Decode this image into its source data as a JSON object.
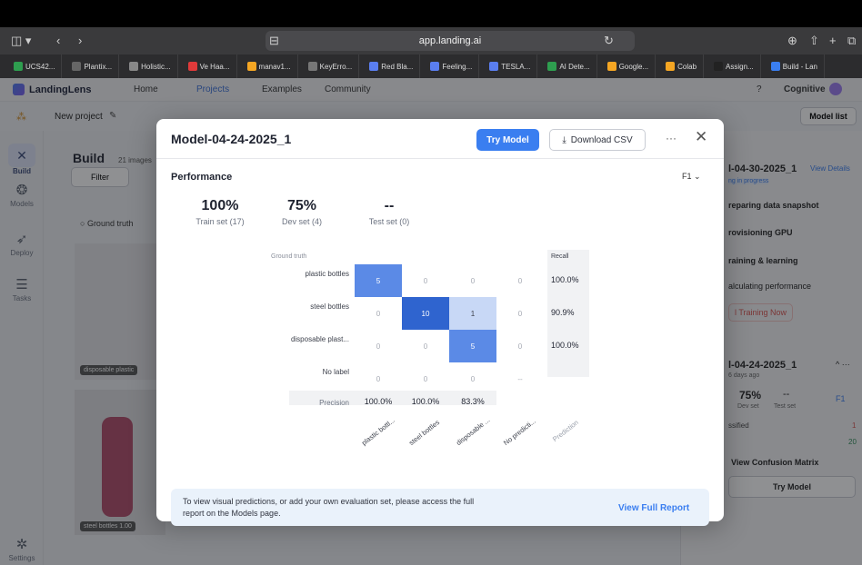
{
  "browser": {
    "url": "app.landing.ai",
    "tabs": [
      "UCS42...",
      "Plantix...",
      "Holistic...",
      "Ve Haa...",
      "manav1...",
      "KeyErro...",
      "Red Bla...",
      "Feeling...",
      "TESLA...",
      "AI Dete...",
      "Google...",
      "Colab",
      "Assign...",
      "Build - Lan"
    ]
  },
  "app": {
    "logo": "LandingLens",
    "nav": [
      "Home",
      "Projects",
      "Examples",
      "Community"
    ],
    "user": "Cognitive",
    "project": "New project",
    "model_list": "Model list"
  },
  "sidebar": [
    {
      "label": "Build",
      "icon": "wrench-icon"
    },
    {
      "label": "Models",
      "icon": "models-icon"
    },
    {
      "label": "Deploy",
      "icon": "rocket-icon"
    },
    {
      "label": "Tasks",
      "icon": "tasks-icon"
    },
    {
      "label": "Settings",
      "icon": "gear-icon"
    }
  ],
  "build": {
    "title": "Build",
    "count": "21 images",
    "filter": "Filter",
    "ground_truth": "Ground truth",
    "tag1": "disposable plastic",
    "tag2": "steel bottles 1.00"
  },
  "right": {
    "model1": "l-04-30-2025_1",
    "view_details": "View Details",
    "status": "ng in progress",
    "steps": [
      "reparing data snapshot",
      "rovisioning GPU",
      "raining & learning",
      "alculating performance"
    ],
    "stop": "l Training Now",
    "model2": "l-04-24-2025_1",
    "ago": "6 days ago",
    "dev": "75%",
    "test": "--",
    "devl": "Dev set",
    "testl": "Test set",
    "f1": "F1",
    "miscl": "ssified",
    "misc_n": "1",
    "t_n": "20",
    "view_cm": "View Confusion Matrix",
    "try": "Try Model"
  },
  "modal": {
    "title": "Model-04-24-2025_1",
    "try_model": "Try Model",
    "download": "Download CSV",
    "performance": "Performance",
    "metric": "F1",
    "stats": [
      {
        "value": "100%",
        "label": "Train set (17)"
      },
      {
        "value": "75%",
        "label": "Dev set (4)"
      },
      {
        "value": "--",
        "label": "Test set (0)"
      }
    ],
    "footer": "To view visual predictions, or add your own evaluation set, please access the full report on the Models page.",
    "footer_link": "View Full Report"
  },
  "chart_data": {
    "type": "heatmap",
    "title": "",
    "row_header": "Ground truth",
    "col_header": "Prediction",
    "rows": [
      "plastic bottles",
      "steel bottles",
      "disposable plast...",
      "No label"
    ],
    "cols": [
      "plastic bottl...",
      "steel bottles",
      "disposable ...",
      "No predicti..."
    ],
    "values": [
      [
        5,
        0,
        0,
        0
      ],
      [
        0,
        10,
        1,
        0
      ],
      [
        0,
        0,
        5,
        0
      ],
      [
        0,
        0,
        0,
        "--"
      ]
    ],
    "recall_header": "Recall",
    "recall": [
      "100.0%",
      "90.9%",
      "100.0%",
      ""
    ],
    "precision_label": "Precision",
    "precision": [
      "100.0%",
      "100.0%",
      "83.3%",
      ""
    ],
    "colors": {
      "high": "#2f64cf",
      "mid": "#5b8ae6",
      "low": "#c8d8f6"
    }
  }
}
